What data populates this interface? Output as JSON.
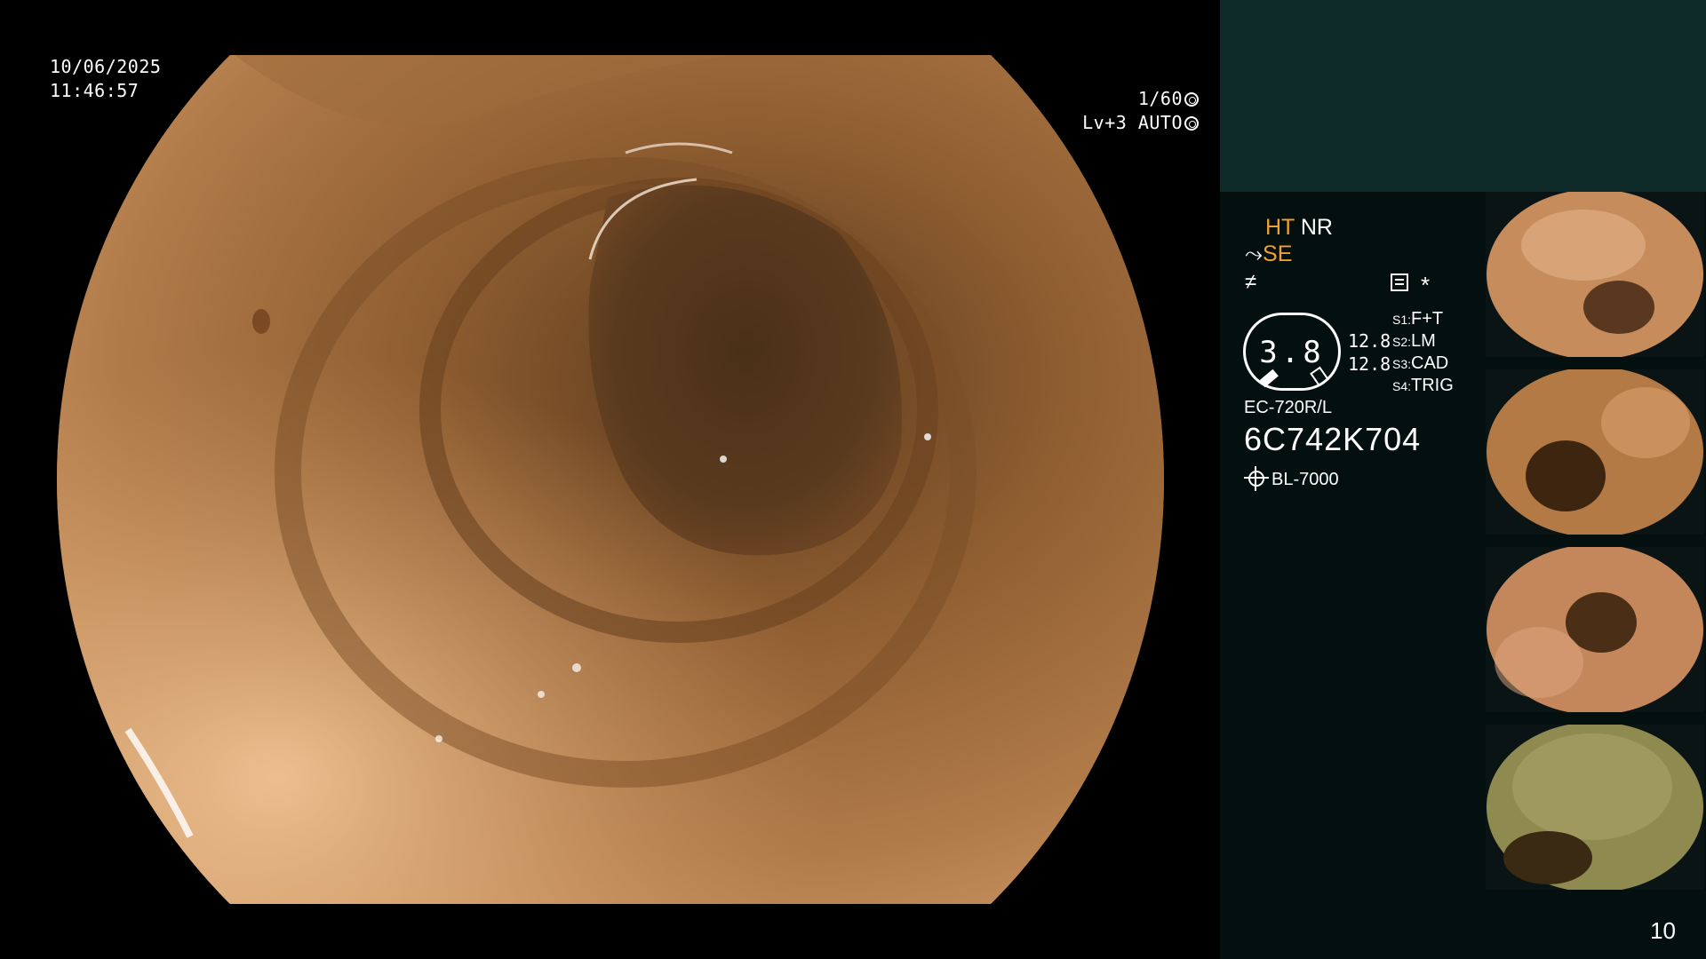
{
  "overlay": {
    "date": "10/06/2025",
    "time": "11:46:57",
    "shutter": "1/60",
    "level": "Lv+3",
    "exposure_mode": "AUTO"
  },
  "info": {
    "ht": "HT",
    "nr": "NR",
    "se": "SE",
    "gauge_value": "3.8",
    "value_1": "12.8",
    "value_2": "12.8",
    "switches": [
      {
        "key": "S1:",
        "value": "F+T"
      },
      {
        "key": "S2:",
        "value": "LM"
      },
      {
        "key": "S3:",
        "value": "CAD"
      },
      {
        "key": "S4:",
        "value": "TRIG"
      }
    ],
    "scope_model": "EC-720R/L",
    "scope_serial": "6C742K704",
    "light_source": "BL-7000",
    "star": "*"
  },
  "colors": {
    "accent_orange": "#f0a030",
    "panel_teal": "#0e2b29",
    "panel_dark": "#041010"
  },
  "icons": {
    "shutter": "shutter-gear-icon",
    "auto": "auto-gear-icon",
    "se_prefix": "scope-tip-icon",
    "filter": "filter-icon",
    "menu": "menu-icon",
    "light": "sun-icon"
  },
  "thumbnails": [
    {
      "id": 1,
      "tone": "#c68c5c"
    },
    {
      "id": 2,
      "tone": "#b37a45"
    },
    {
      "id": 3,
      "tone": "#c4875c"
    },
    {
      "id": 4,
      "tone": "#8f8a4f"
    }
  ],
  "page_number": "10"
}
